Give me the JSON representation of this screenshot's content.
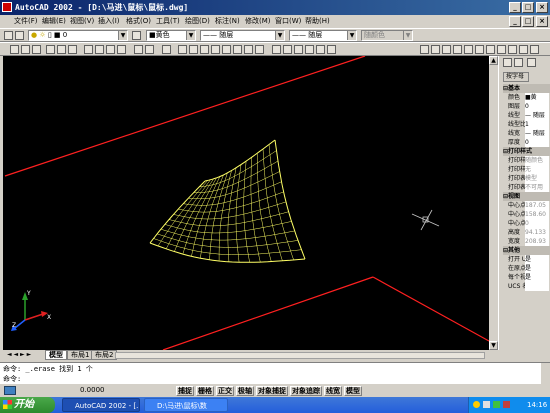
{
  "titlebar": {
    "text": "AutoCAD 2002 - [D:\\马进\\鼠标\\鼠标.dwg]"
  },
  "menu": [
    "文件(F)",
    "编辑(E)",
    "视图(V)",
    "插入(I)",
    "格式(O)",
    "工具(T)",
    "绘图(D)",
    "标注(N)",
    "修改(M)",
    "窗口(W)",
    "帮助(H)"
  ],
  "layer_toolbar": {
    "layer_value": "0",
    "color_value": "■黄色",
    "linetype_value": "—— 随层",
    "lineweight_value": "—— 随层",
    "plotstyle_value": "随颜色"
  },
  "layout_tabs": [
    "模型",
    "布局1",
    "布局2"
  ],
  "command": {
    "line1": "命令: _.erase 找到 1 个",
    "line2": "命令:"
  },
  "status": {
    "coords": "0.0000",
    "buttons": [
      "捕捉",
      "栅格",
      "正交",
      "极轴",
      "对象捕捉",
      "对象追踪",
      "线宽",
      "模型"
    ]
  },
  "properties": {
    "tab_label": "按字母",
    "sections": [
      {
        "title": "基本",
        "rows": [
          [
            "颜色",
            "■黄"
          ],
          [
            "图层",
            "0"
          ],
          [
            "线型",
            "— 随层"
          ],
          [
            "线型比例",
            "1"
          ],
          [
            "线宽",
            "— 随层"
          ],
          [
            "厚度",
            "0"
          ]
        ]
      },
      {
        "title": "打印样式",
        "rows": [
          [
            "打印样式",
            "随颜色"
          ],
          [
            "打印样式表",
            "无"
          ],
          [
            "打印表附着到",
            "模型"
          ],
          [
            "打印表类型",
            "不可用"
          ]
        ]
      },
      {
        "title": "视图",
        "rows": [
          [
            "中心点 X",
            "187.05"
          ],
          [
            "中心点 Y",
            "158.60"
          ],
          [
            "中心点 Z",
            "0"
          ],
          [
            "高度",
            "94.133"
          ],
          [
            "宽度",
            "208.93"
          ]
        ]
      },
      {
        "title": "其他",
        "rows": [
          [
            "打开 UCS",
            "是"
          ],
          [
            "在原点显示",
            "是"
          ],
          [
            "每个视口",
            "是"
          ],
          [
            "UCS 名称",
            ""
          ]
        ]
      }
    ]
  },
  "taskbar": {
    "start": "开始",
    "tasks": [
      "AutoCAD 2002 - [...",
      "D:\\马进\\鼠标\\数"
    ],
    "clock": "14:16"
  },
  "colors": {
    "canvas": "#000000",
    "surface": "#ffff66",
    "boundary": "#ff0000",
    "titlebar": "#0a246a"
  }
}
